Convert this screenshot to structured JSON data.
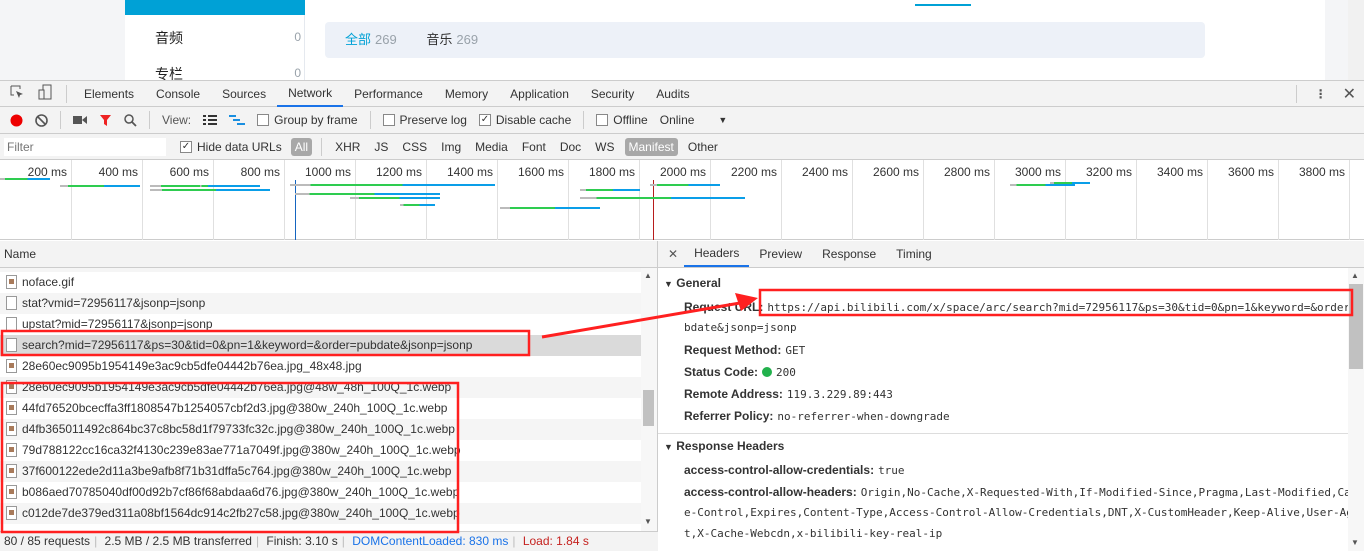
{
  "page": {
    "sidebar": [
      {
        "label": "音频",
        "count": "0"
      },
      {
        "label": "专栏",
        "count": "0"
      }
    ],
    "filters": [
      {
        "label": "全部",
        "count": "269"
      },
      {
        "label": "音乐",
        "count": "269"
      }
    ]
  },
  "devtools": {
    "tabs": [
      "Elements",
      "Console",
      "Sources",
      "Network",
      "Performance",
      "Memory",
      "Application",
      "Security",
      "Audits"
    ],
    "active_tab": "Network",
    "toolbar": {
      "view_label": "View:",
      "group_by_frame": "Group by frame",
      "preserve_log": "Preserve log",
      "disable_cache": "Disable cache",
      "offline": "Offline",
      "throttle": "Online",
      "disable_cache_checked": true
    },
    "filter": {
      "placeholder": "Filter",
      "hide_data_urls": "Hide data URLs",
      "types": [
        "All",
        "XHR",
        "JS",
        "CSS",
        "Img",
        "Media",
        "Font",
        "Doc",
        "WS",
        "Manifest",
        "Other"
      ]
    },
    "timeline": {
      "ticks": [
        "200 ms",
        "400 ms",
        "600 ms",
        "800 ms",
        "1000 ms",
        "1200 ms",
        "1400 ms",
        "1600 ms",
        "1800 ms",
        "2000 ms",
        "2200 ms",
        "2400 ms",
        "2600 ms",
        "2800 ms",
        "3000 ms",
        "3200 ms",
        "3400 ms",
        "3600 ms",
        "3800 ms"
      ],
      "dom_content_loaded_ms": 830,
      "load_ms": 1840
    },
    "requests": {
      "header": "Name",
      "rows": [
        {
          "name": "noface.gif",
          "type": "img"
        },
        {
          "name": "stat?vmid=72956117&jsonp=jsonp",
          "type": "doc"
        },
        {
          "name": "upstat?mid=72956117&jsonp=jsonp",
          "type": "doc"
        },
        {
          "name": "search?mid=72956117&ps=30&tid=0&pn=1&keyword=&order=pubdate&jsonp=jsonp",
          "type": "doc",
          "selected": true
        },
        {
          "name": "28e60ec9095b1954149e3ac9cb5dfe04442b76ea.jpg_48x48.jpg",
          "type": "img"
        },
        {
          "name": "28e60ec9095b1954149e3ac9cb5dfe04442b76ea.jpg@48w_48h_100Q_1c.webp",
          "type": "img"
        },
        {
          "name": "44fd76520bcecffa3ff1808547b1254057cbf2d3.jpg@380w_240h_100Q_1c.webp",
          "type": "img"
        },
        {
          "name": "d4fb365011492c864bc37c8bc58d1f79733fc32c.jpg@380w_240h_100Q_1c.webp",
          "type": "img"
        },
        {
          "name": "79d788122cc16ca32f4130c239e83ae771a7049f.jpg@380w_240h_100Q_1c.webp",
          "type": "img"
        },
        {
          "name": "37f600122ede2d11a3be9afb8f71b31dffa5c764.jpg@380w_240h_100Q_1c.webp",
          "type": "img"
        },
        {
          "name": "b086aed70785040df00d92b7cf86f68abdaa6d76.jpg@380w_240h_100Q_1c.webp",
          "type": "img"
        },
        {
          "name": "c012de7de379ed311a08bf1564dc914c2fb27c58.jpg@380w_240h_100Q_1c.webp",
          "type": "img"
        }
      ]
    },
    "status": {
      "requests": "80 / 85 requests",
      "transferred": "2.5 MB / 2.5 MB transferred",
      "finish": "Finish: 3.10 s",
      "dcl": "DOMContentLoaded: 830 ms",
      "load": "Load: 1.84 s"
    },
    "details": {
      "tabs": [
        "Headers",
        "Preview",
        "Response",
        "Timing"
      ],
      "active": "Headers",
      "general_title": "General",
      "request_url_label": "Request URL:",
      "request_url": "https://api.bilibili.com/x/space/arc/search?mid=72956117&ps=30&tid=0&pn=1&keyword=&order=",
      "request_url_cont": "bdate&jsonp=jsonp",
      "method_label": "Request Method:",
      "method": "GET",
      "status_label": "Status Code:",
      "status": "200",
      "status_color": "#22b14c",
      "remote_label": "Remote Address:",
      "remote": "119.3.229.89:443",
      "referrer_label": "Referrer Policy:",
      "referrer": "no-referrer-when-downgrade",
      "response_title": "Response Headers",
      "h1_label": "access-control-allow-credentials:",
      "h1": "true",
      "h2_label": "access-control-allow-headers:",
      "h2a": "Origin,No-Cache,X-Requested-With,If-Modified-Since,Pragma,Last-Modified,Cac",
      "h2b": "e-Control,Expires,Content-Type,Access-Control-Allow-Credentials,DNT,X-CustomHeader,Keep-Alive,User-Ag",
      "h2c": "t,X-Cache-Webcdn,x-bilibili-key-real-ip"
    }
  },
  "colors": {
    "accent": "#00a1d6",
    "annotation": "#ff2020",
    "dcl_line": "#1565c0",
    "load_line": "#b71c1c"
  }
}
